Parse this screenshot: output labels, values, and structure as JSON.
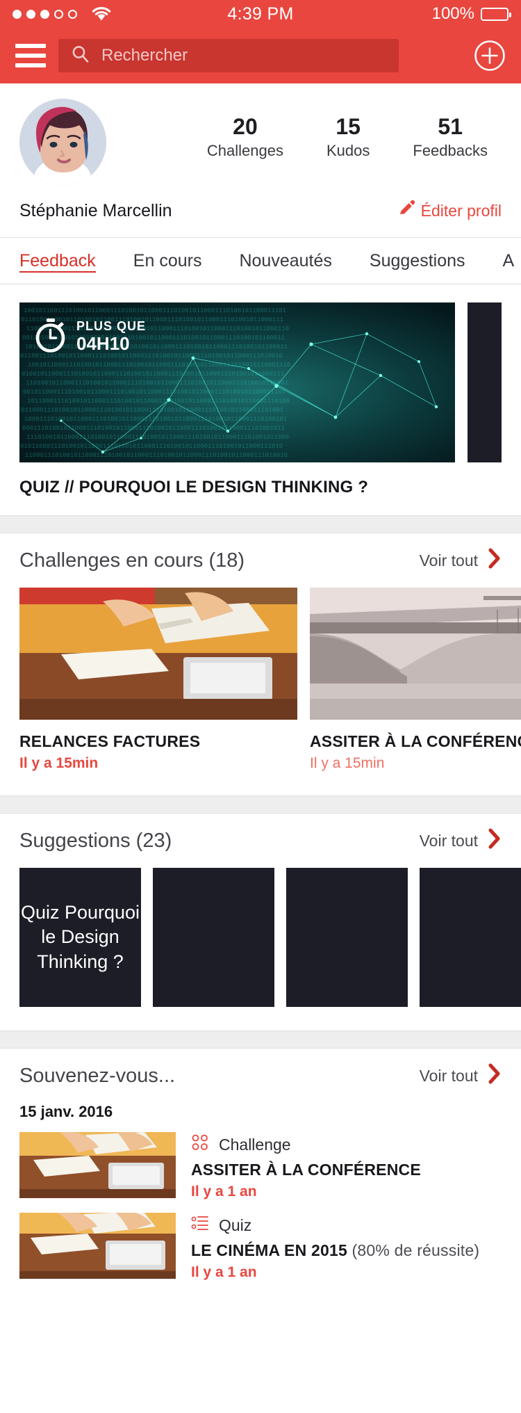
{
  "status_bar": {
    "signal_dots_filled": 3,
    "signal_dots_total": 5,
    "wifi": "wifi-icon",
    "time": "4:39 PM",
    "battery_percent": "100%"
  },
  "nav": {
    "menu_icon": "hamburger-menu-icon",
    "search_placeholder": "Rechercher",
    "search_value": "",
    "search_icon": "search-icon",
    "add_icon": "plus-circle-icon"
  },
  "profile": {
    "name": "Stéphanie Marcellin",
    "avatar": "user-avatar",
    "edit_label": "Éditer profil",
    "edit_icon": "pencil-icon",
    "stats": [
      {
        "value": "20",
        "label": "Challenges"
      },
      {
        "value": "15",
        "label": "Kudos"
      },
      {
        "value": "51",
        "label": "Feedbacks"
      }
    ]
  },
  "tabs": [
    {
      "label": "Feedback",
      "active": true
    },
    {
      "label": "En cours",
      "active": false
    },
    {
      "label": "Nouveautés",
      "active": false
    },
    {
      "label": "Suggestions",
      "active": false
    },
    {
      "label": "A",
      "active": false
    }
  ],
  "featured": {
    "timer_prefix": "PLUS QUE",
    "timer_value": "04H10",
    "timer_icon": "stopwatch-icon",
    "title": "QUIZ // POURQUOI LE DESIGN THINKING ?"
  },
  "challenges_section": {
    "title": "Challenges en cours (18)",
    "see_all": "Voir tout",
    "chevron_icon": "chevron-right-icon",
    "items": [
      {
        "name": "RELANCES FACTURES",
        "time": "Il y a 15min",
        "image": "desk-papers-photo"
      },
      {
        "name": "ASSITER À LA CONFÉRENCE",
        "time": "Il y a 15min",
        "image": "bridge-photo"
      }
    ]
  },
  "suggestions_section": {
    "title": "Suggestions (23)",
    "see_all": "Voir tout",
    "chevron_icon": "chevron-right-icon",
    "items": [
      {
        "text": "Quiz Pourquoi le Design Thinking ?"
      },
      {
        "text": ""
      },
      {
        "text": ""
      },
      {
        "text": ""
      }
    ]
  },
  "memories_section": {
    "title": "Souvenez-vous...",
    "see_all": "Voir tout",
    "chevron_icon": "chevron-right-icon",
    "date": "15 janv. 2016",
    "items": [
      {
        "kind": "Challenge",
        "kind_icon": "challenge-dots-icon",
        "title": "ASSITER À LA CONFÉRENCE",
        "score": "",
        "time": "Il y a 1 an",
        "image": "desk-papers-photo"
      },
      {
        "kind": "Quiz",
        "kind_icon": "quiz-list-icon",
        "title": "LE CINÉMA EN 2015",
        "score": " (80% de réussite)",
        "time": "Il y a 1 an",
        "image": "desk-papers-photo"
      }
    ]
  },
  "colors": {
    "brand_red": "#e8463f",
    "brand_red_dark": "#c9352f",
    "accent_red": "#d63027",
    "dark_card": "#1d1d28",
    "page_gap": "#eeeeee"
  }
}
